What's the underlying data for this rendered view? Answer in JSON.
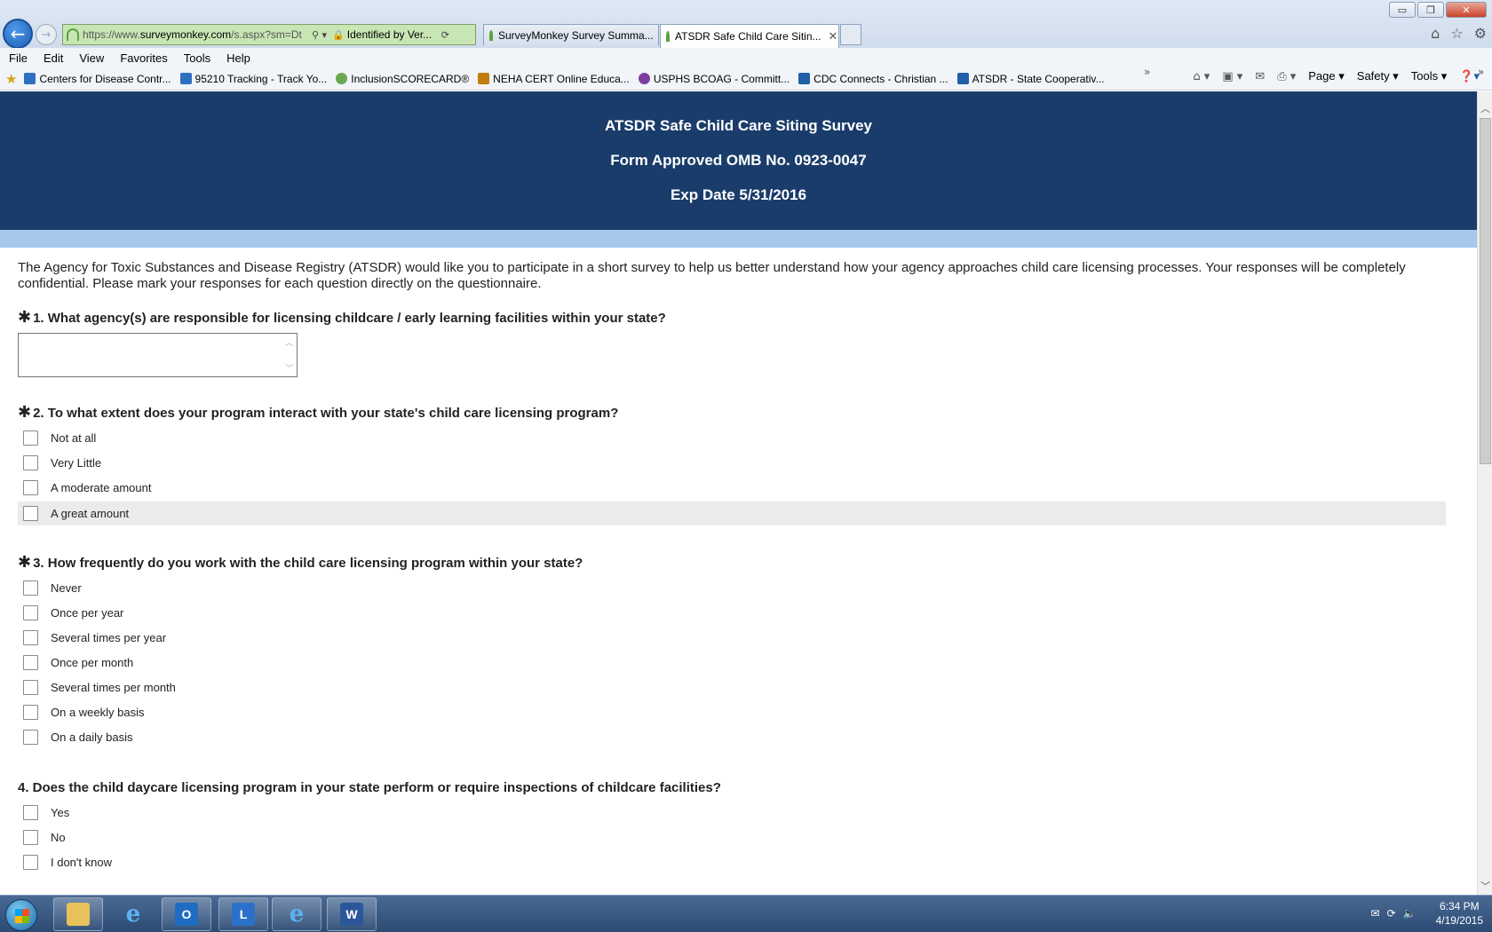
{
  "window": {
    "controls": [
      "▭",
      "❐",
      "✕"
    ]
  },
  "address": {
    "url_prefix": "https://www.",
    "url_host": "surveymonkey.com",
    "url_path": "/s.aspx?sm=Dt",
    "identity": "Identified by Ver..."
  },
  "tabs": [
    {
      "label": "SurveyMonkey Survey Summa...",
      "active": false
    },
    {
      "label": "ATSDR Safe Child Care Sitin...",
      "active": true
    }
  ],
  "menu": [
    "File",
    "Edit",
    "View",
    "Favorites",
    "Tools",
    "Help"
  ],
  "favorites": [
    {
      "label": "Centers for Disease Contr...",
      "color": "#2f6fc0"
    },
    {
      "label": "95210 Tracking - Track Yo...",
      "color": "#2f6fc0"
    },
    {
      "label": "InclusionSCORECARD®",
      "color": "#6aa84f"
    },
    {
      "label": "NEHA CERT Online Educa...",
      "color": "#c27c0e"
    },
    {
      "label": "USPHS BCOAG - Committ...",
      "color": "#7b3fa0"
    },
    {
      "label": "CDC Connects - Christian ...",
      "color": "#1f5fa8"
    },
    {
      "label": "ATSDR - State Cooperativ...",
      "color": "#1f5fa8"
    }
  ],
  "commands": [
    "Page",
    "Safety",
    "Tools"
  ],
  "survey": {
    "header": [
      "ATSDR Safe Child Care Siting Survey",
      "Form Approved OMB No. 0923-0047",
      "Exp Date 5/31/2016"
    ],
    "intro": "The Agency for Toxic Substances and Disease Registry (ATSDR) would like you to participate in a short survey to help us better understand how your agency approaches child care licensing processes. Your responses will be completely confidential. Please mark your responses for each question directly on the questionnaire.",
    "questions": [
      {
        "text": "1. What agency(s) are responsible for licensing childcare / early learning facilities within your state?",
        "required": true
      },
      {
        "text": "2. To what extent does your program interact with your state's child care licensing program?",
        "required": true,
        "options": [
          "Not at all",
          "Very Little",
          "A moderate amount",
          "A great amount"
        ]
      },
      {
        "text": "3. How frequently do you work with the child care licensing program within your state?",
        "required": true,
        "options": [
          "Never",
          "Once per year",
          "Several times per year",
          "Once per month",
          "Several times per month",
          "On a weekly basis",
          "On a daily basis"
        ]
      },
      {
        "text": "4. Does the child daycare licensing program in your state perform or require inspections of childcare facilities?",
        "required": false,
        "options": [
          "Yes",
          "No",
          "I don't know"
        ]
      }
    ],
    "required_marker": "✱"
  },
  "taskbar": {
    "time": "6:34 PM",
    "date": "4/19/2015"
  }
}
